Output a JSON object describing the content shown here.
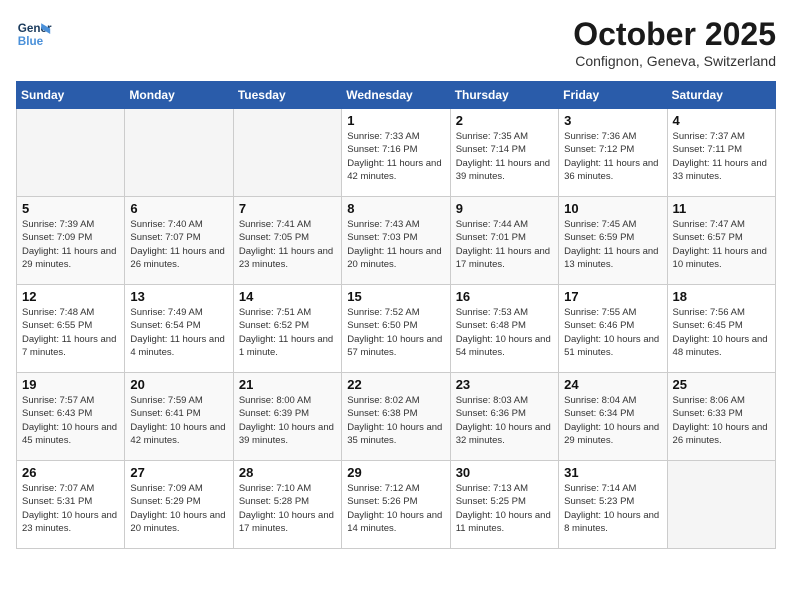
{
  "logo": {
    "line1": "General",
    "line2": "Blue"
  },
  "title": "October 2025",
  "subtitle": "Confignon, Geneva, Switzerland",
  "weekdays": [
    "Sunday",
    "Monday",
    "Tuesday",
    "Wednesday",
    "Thursday",
    "Friday",
    "Saturday"
  ],
  "weeks": [
    [
      {
        "day": "",
        "info": ""
      },
      {
        "day": "",
        "info": ""
      },
      {
        "day": "",
        "info": ""
      },
      {
        "day": "1",
        "info": "Sunrise: 7:33 AM\nSunset: 7:16 PM\nDaylight: 11 hours\nand 42 minutes."
      },
      {
        "day": "2",
        "info": "Sunrise: 7:35 AM\nSunset: 7:14 PM\nDaylight: 11 hours\nand 39 minutes."
      },
      {
        "day": "3",
        "info": "Sunrise: 7:36 AM\nSunset: 7:12 PM\nDaylight: 11 hours\nand 36 minutes."
      },
      {
        "day": "4",
        "info": "Sunrise: 7:37 AM\nSunset: 7:11 PM\nDaylight: 11 hours\nand 33 minutes."
      }
    ],
    [
      {
        "day": "5",
        "info": "Sunrise: 7:39 AM\nSunset: 7:09 PM\nDaylight: 11 hours\nand 29 minutes."
      },
      {
        "day": "6",
        "info": "Sunrise: 7:40 AM\nSunset: 7:07 PM\nDaylight: 11 hours\nand 26 minutes."
      },
      {
        "day": "7",
        "info": "Sunrise: 7:41 AM\nSunset: 7:05 PM\nDaylight: 11 hours\nand 23 minutes."
      },
      {
        "day": "8",
        "info": "Sunrise: 7:43 AM\nSunset: 7:03 PM\nDaylight: 11 hours\nand 20 minutes."
      },
      {
        "day": "9",
        "info": "Sunrise: 7:44 AM\nSunset: 7:01 PM\nDaylight: 11 hours\nand 17 minutes."
      },
      {
        "day": "10",
        "info": "Sunrise: 7:45 AM\nSunset: 6:59 PM\nDaylight: 11 hours\nand 13 minutes."
      },
      {
        "day": "11",
        "info": "Sunrise: 7:47 AM\nSunset: 6:57 PM\nDaylight: 11 hours\nand 10 minutes."
      }
    ],
    [
      {
        "day": "12",
        "info": "Sunrise: 7:48 AM\nSunset: 6:55 PM\nDaylight: 11 hours\nand 7 minutes."
      },
      {
        "day": "13",
        "info": "Sunrise: 7:49 AM\nSunset: 6:54 PM\nDaylight: 11 hours\nand 4 minutes."
      },
      {
        "day": "14",
        "info": "Sunrise: 7:51 AM\nSunset: 6:52 PM\nDaylight: 11 hours\nand 1 minute."
      },
      {
        "day": "15",
        "info": "Sunrise: 7:52 AM\nSunset: 6:50 PM\nDaylight: 10 hours\nand 57 minutes."
      },
      {
        "day": "16",
        "info": "Sunrise: 7:53 AM\nSunset: 6:48 PM\nDaylight: 10 hours\nand 54 minutes."
      },
      {
        "day": "17",
        "info": "Sunrise: 7:55 AM\nSunset: 6:46 PM\nDaylight: 10 hours\nand 51 minutes."
      },
      {
        "day": "18",
        "info": "Sunrise: 7:56 AM\nSunset: 6:45 PM\nDaylight: 10 hours\nand 48 minutes."
      }
    ],
    [
      {
        "day": "19",
        "info": "Sunrise: 7:57 AM\nSunset: 6:43 PM\nDaylight: 10 hours\nand 45 minutes."
      },
      {
        "day": "20",
        "info": "Sunrise: 7:59 AM\nSunset: 6:41 PM\nDaylight: 10 hours\nand 42 minutes."
      },
      {
        "day": "21",
        "info": "Sunrise: 8:00 AM\nSunset: 6:39 PM\nDaylight: 10 hours\nand 39 minutes."
      },
      {
        "day": "22",
        "info": "Sunrise: 8:02 AM\nSunset: 6:38 PM\nDaylight: 10 hours\nand 35 minutes."
      },
      {
        "day": "23",
        "info": "Sunrise: 8:03 AM\nSunset: 6:36 PM\nDaylight: 10 hours\nand 32 minutes."
      },
      {
        "day": "24",
        "info": "Sunrise: 8:04 AM\nSunset: 6:34 PM\nDaylight: 10 hours\nand 29 minutes."
      },
      {
        "day": "25",
        "info": "Sunrise: 8:06 AM\nSunset: 6:33 PM\nDaylight: 10 hours\nand 26 minutes."
      }
    ],
    [
      {
        "day": "26",
        "info": "Sunrise: 7:07 AM\nSunset: 5:31 PM\nDaylight: 10 hours\nand 23 minutes."
      },
      {
        "day": "27",
        "info": "Sunrise: 7:09 AM\nSunset: 5:29 PM\nDaylight: 10 hours\nand 20 minutes."
      },
      {
        "day": "28",
        "info": "Sunrise: 7:10 AM\nSunset: 5:28 PM\nDaylight: 10 hours\nand 17 minutes."
      },
      {
        "day": "29",
        "info": "Sunrise: 7:12 AM\nSunset: 5:26 PM\nDaylight: 10 hours\nand 14 minutes."
      },
      {
        "day": "30",
        "info": "Sunrise: 7:13 AM\nSunset: 5:25 PM\nDaylight: 10 hours\nand 11 minutes."
      },
      {
        "day": "31",
        "info": "Sunrise: 7:14 AM\nSunset: 5:23 PM\nDaylight: 10 hours\nand 8 minutes."
      },
      {
        "day": "",
        "info": ""
      }
    ]
  ]
}
